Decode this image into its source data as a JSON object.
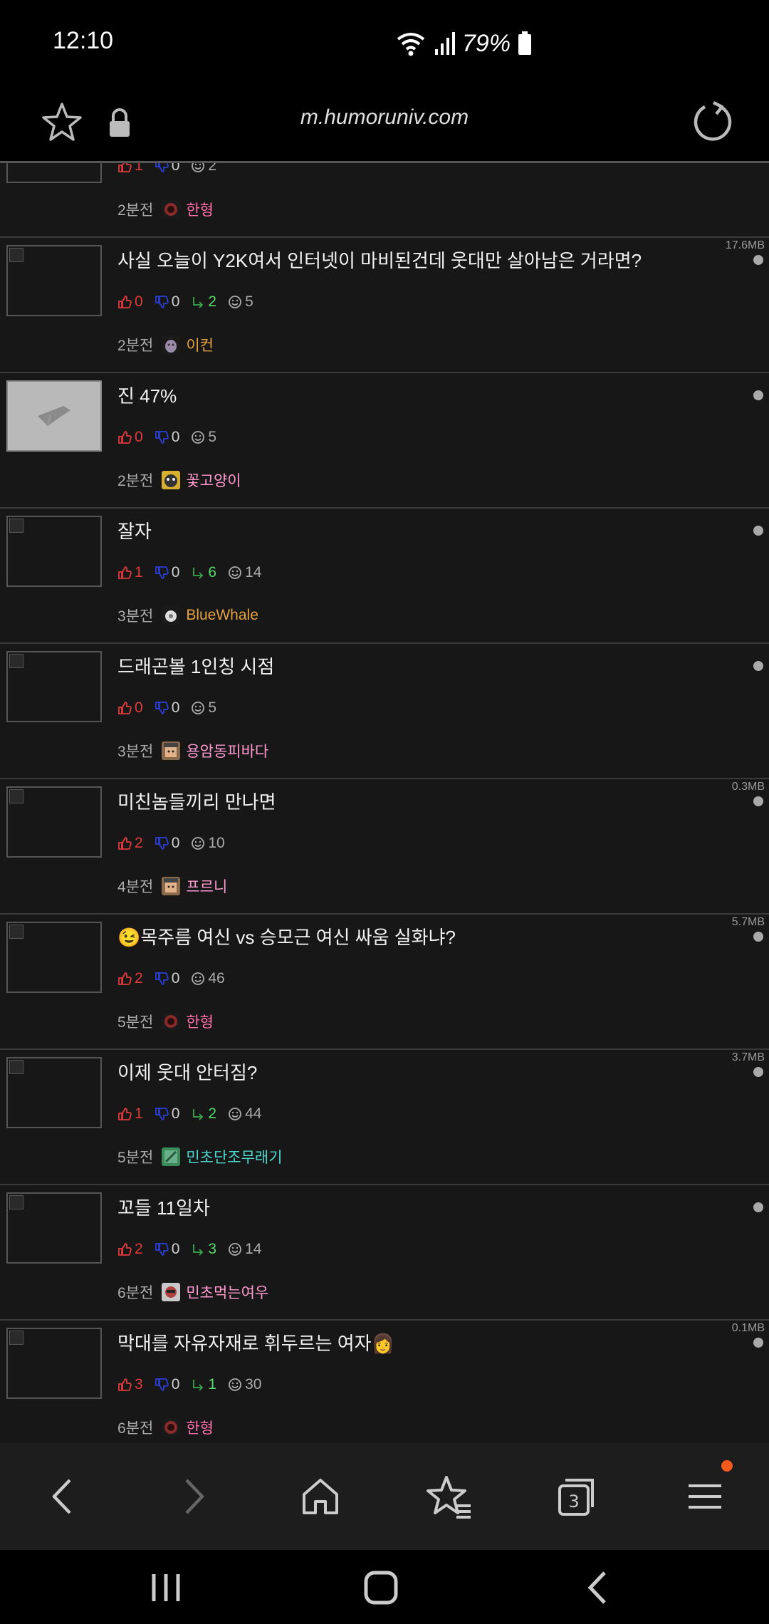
{
  "status_bar": {
    "time": "12:10",
    "battery_percent": "79%"
  },
  "browser": {
    "url": "m.humoruniv.com"
  },
  "partial_post": {
    "up": "1",
    "down": "0",
    "views": "2",
    "time_ago": "2분전",
    "author": "한형",
    "author_color": "#ff6fa8",
    "size": "17.6MB"
  },
  "posts": [
    {
      "title": "사실 오늘이 Y2K여서 인터넷이 마비된건데 웃대만 살아남은 거라면?",
      "up": "0",
      "down": "0",
      "share": "2",
      "views": "5",
      "time_ago": "2분전",
      "author": "이컨",
      "author_color": "#e5a040",
      "size": ""
    },
    {
      "title": "진 47%",
      "up": "0",
      "down": "0",
      "share": "",
      "views": "5",
      "time_ago": "2분전",
      "author": "꽃고양이",
      "author_color": "#ff9ad0",
      "size": ""
    },
    {
      "title": "잘자",
      "up": "1",
      "down": "0",
      "share": "6",
      "views": "14",
      "time_ago": "3분전",
      "author": "BlueWhale",
      "author_color": "#e5a040",
      "size": ""
    },
    {
      "title": "드래곤볼 1인칭 시점",
      "up": "0",
      "down": "0",
      "share": "",
      "views": "5",
      "time_ago": "3분전",
      "author": "용암동피바다",
      "author_color": "#ff9ad0",
      "size": "0.3MB"
    },
    {
      "title": "미친놈들끼리 만나면",
      "up": "2",
      "down": "0",
      "share": "",
      "views": "10",
      "time_ago": "4분전",
      "author": "프르니",
      "author_color": "#ff9ad0",
      "size": "5.7MB"
    },
    {
      "title": "😉목주름 여신 vs 승모근 여신 싸움 실화냐?",
      "up": "2",
      "down": "0",
      "share": "",
      "views": "46",
      "time_ago": "5분전",
      "author": "한형",
      "author_color": "#ff6fa8",
      "size": "3.7MB"
    },
    {
      "title": "이제 웃대 안터짐?",
      "up": "1",
      "down": "0",
      "share": "2",
      "views": "44",
      "time_ago": "5분전",
      "author": "민초단조무래기",
      "author_color": "#4fd6cf",
      "size": ""
    },
    {
      "title": "꼬들 11일차",
      "up": "2",
      "down": "0",
      "share": "3",
      "views": "14",
      "time_ago": "6분전",
      "author": "민초먹는여우",
      "author_color": "#ff9ad0",
      "size": "0.1MB"
    },
    {
      "title": "막대를 자유자재로 휘두르는 여자👩",
      "up": "3",
      "down": "0",
      "share": "1",
      "views": "30",
      "time_ago": "6분전",
      "author": "한형",
      "author_color": "#ff6fa8",
      "size": ""
    }
  ]
}
